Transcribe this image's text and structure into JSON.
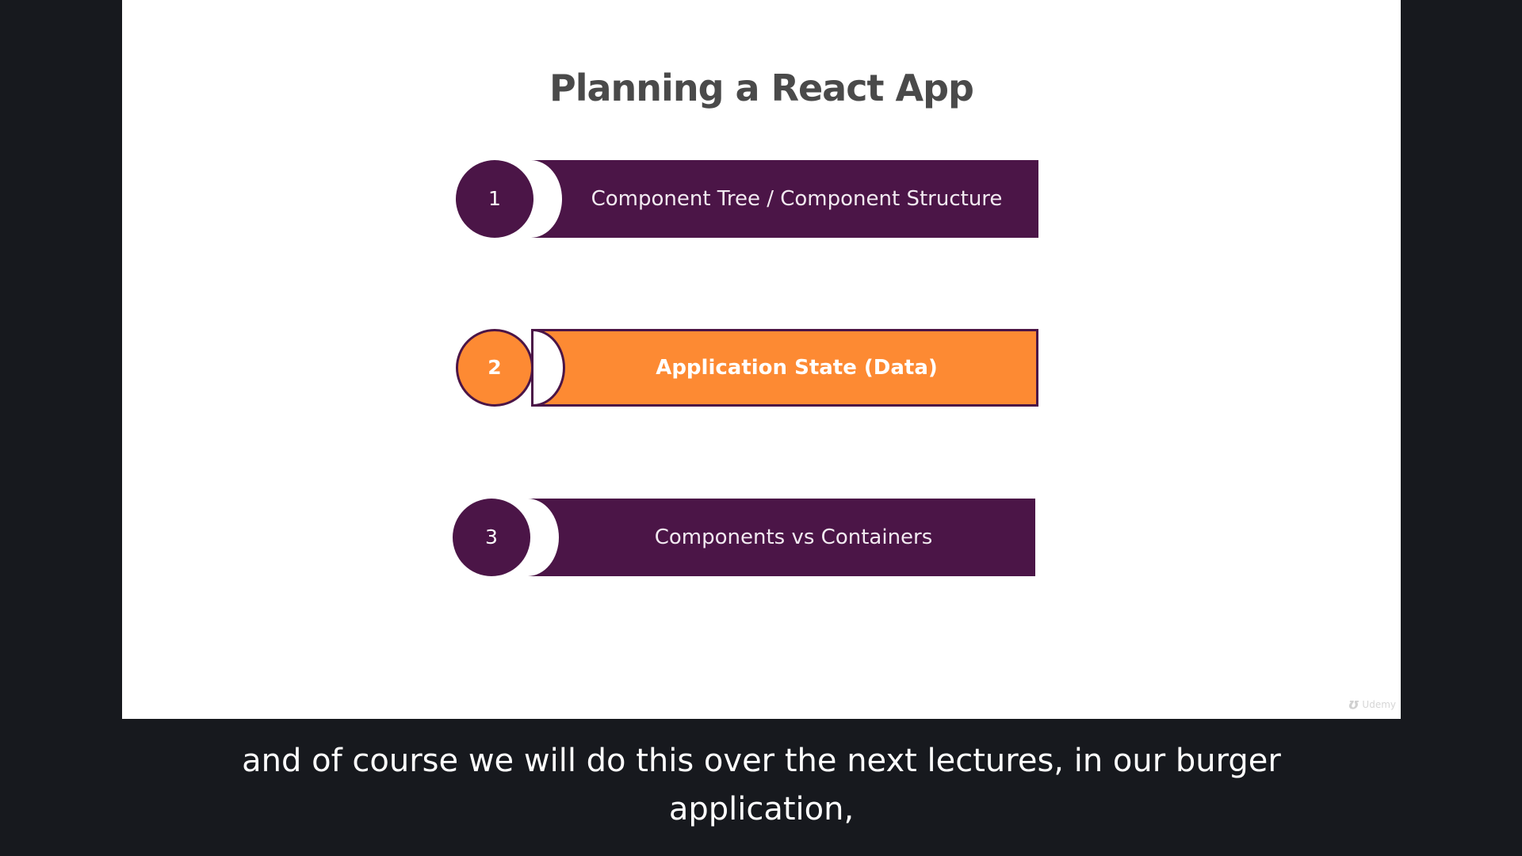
{
  "slide": {
    "title": "Planning a React App",
    "steps": [
      {
        "number": "1",
        "label": "Component Tree / Component Structure",
        "active": false
      },
      {
        "number": "2",
        "label": "Application State (Data)",
        "active": true
      },
      {
        "number": "3",
        "label": "Components vs Containers",
        "active": false
      }
    ],
    "watermark": "Udemy"
  },
  "subtitle": {
    "line1": "and of course we will do this over the next lectures, in our burger",
    "line2": "application,"
  },
  "colors": {
    "purple": "#4b1547",
    "orange": "#fd8a33",
    "background": "#17191e"
  }
}
